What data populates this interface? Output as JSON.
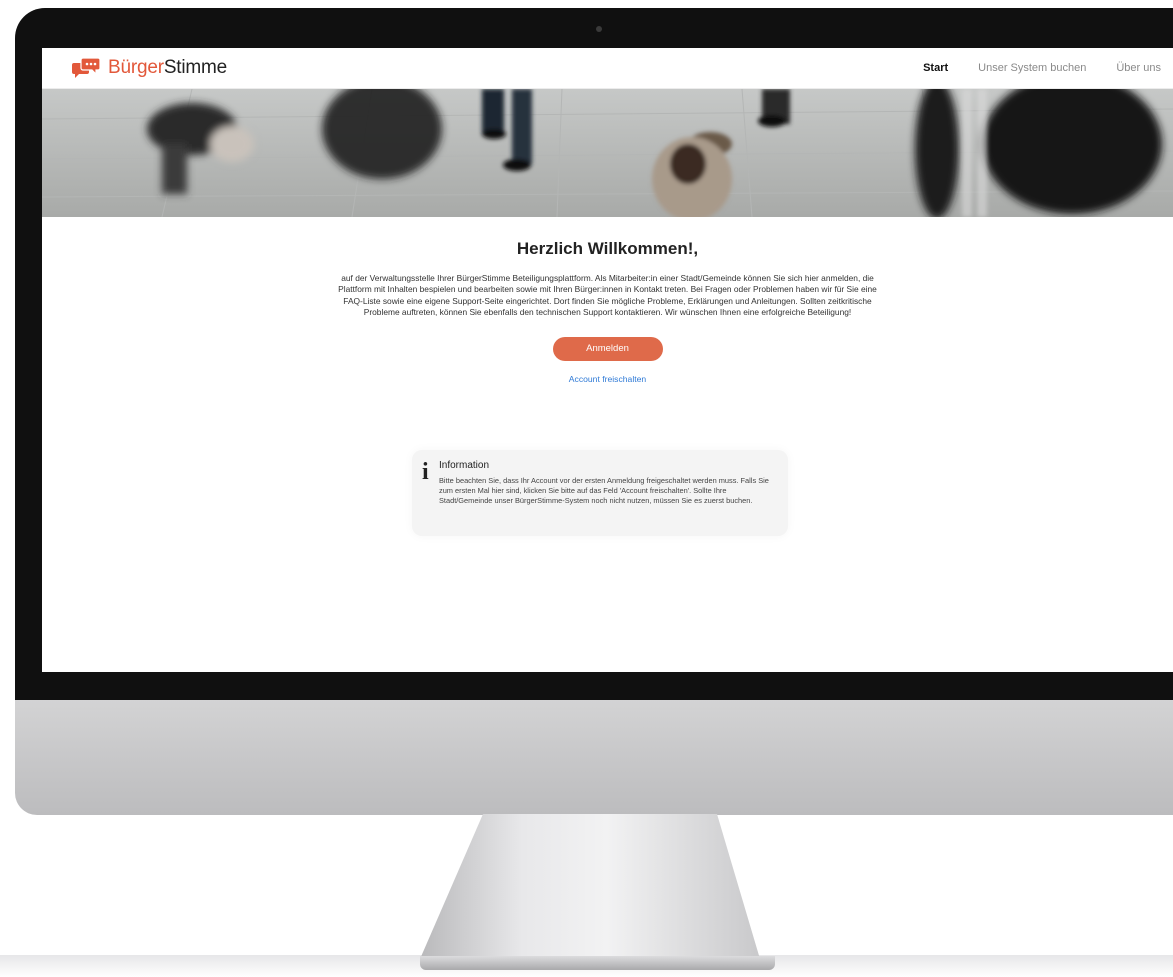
{
  "brand": {
    "logo_part1": "Bürger",
    "logo_part2": "Stimme",
    "accent_color": "#e2583a"
  },
  "nav": {
    "items": [
      {
        "label": "Start",
        "active": true
      },
      {
        "label": "Unser System buchen",
        "active": false
      },
      {
        "label": "Über uns",
        "active": false
      }
    ]
  },
  "main": {
    "title": "Herzlich Willkommen!,",
    "intro": "auf der Verwaltungsstelle Ihrer BürgerStimme Beteiligungsplattform. Als Mitarbeiter:in einer Stadt/Gemeinde können Sie sich hier anmelden, die Plattform mit Inhalten bespielen und bearbeiten sowie mit Ihren Bürger:innen in Kontakt treten. Bei Fragen oder Problemen haben wir für Sie eine FAQ-Liste sowie eine eigene Support-Seite eingerichtet. Dort finden Sie mögliche Probleme, Erklärungen und Anleitungen. Sollten zeitkritische Probleme auftreten, können Sie ebenfalls den technischen Support kontaktieren. Wir wünschen Ihnen eine erfolgreiche Beteiligung!",
    "login_button": "Anmelden",
    "unlock_link": "Account freischalten"
  },
  "info": {
    "icon": "info-icon",
    "title": "Information",
    "text": "Bitte beachten Sie, dass Ihr Account vor der ersten Anmeldung freigeschaltet werden muss. Falls Sie zum ersten Mal hier sind, klicken Sie bitte auf das Feld 'Account freischalten'. Sollte Ihre Stadt/Gemeinde unser BürgerStimme-System noch nicht nutzen, müssen Sie es zuerst buchen."
  },
  "colors": {
    "button": "#df6a4a",
    "link": "#2f7ad6"
  }
}
